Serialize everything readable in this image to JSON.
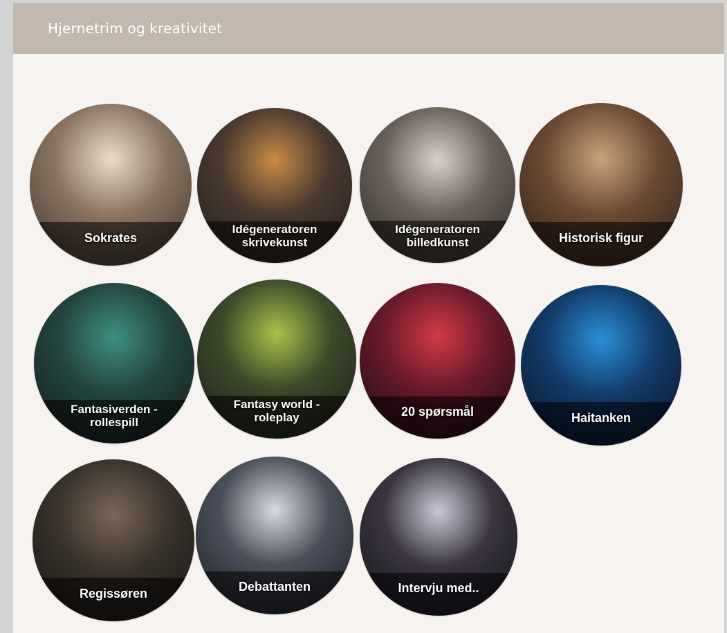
{
  "header": {
    "title": "Hjernetrim og kreativitet"
  },
  "tiles": [
    {
      "label": "Sokrates",
      "colors": [
        "#e9dccb",
        "#8a7562",
        "#3a2f28"
      ]
    },
    {
      "label": "Idégeneratoren\nskrivekunst",
      "colors": [
        "#c98b46",
        "#4a3a30",
        "#1f1b1a"
      ]
    },
    {
      "label": "Idégeneratoren\nbilledkunst",
      "colors": [
        "#d7d2c9",
        "#6b625a",
        "#2b2724"
      ]
    },
    {
      "label": "Historisk figur",
      "colors": [
        "#c9a27a",
        "#6a4a33",
        "#2a1d17"
      ]
    },
    {
      "label": "Fantasiverden -\nrollespill",
      "colors": [
        "#3f8f82",
        "#23453f",
        "#171717"
      ]
    },
    {
      "label": "Fantasy world -\nroleplay",
      "colors": [
        "#a9c24a",
        "#3c4a2a",
        "#1a1a18"
      ]
    },
    {
      "label": "20 spørsmål",
      "colors": [
        "#d23a49",
        "#6a1a2a",
        "#160c14"
      ]
    },
    {
      "label": "Haitanken",
      "colors": [
        "#2b8fd6",
        "#123c6b",
        "#0b0f1e"
      ]
    },
    {
      "label": "Regissøren",
      "colors": [
        "#7b6656",
        "#3a332c",
        "#161413"
      ]
    },
    {
      "label": "Debattanten",
      "colors": [
        "#d7dbe0",
        "#4a4f5a",
        "#1b1c22"
      ]
    },
    {
      "label": "Intervju med..",
      "colors": [
        "#c9c9d6",
        "#3a3540",
        "#121116"
      ]
    }
  ]
}
